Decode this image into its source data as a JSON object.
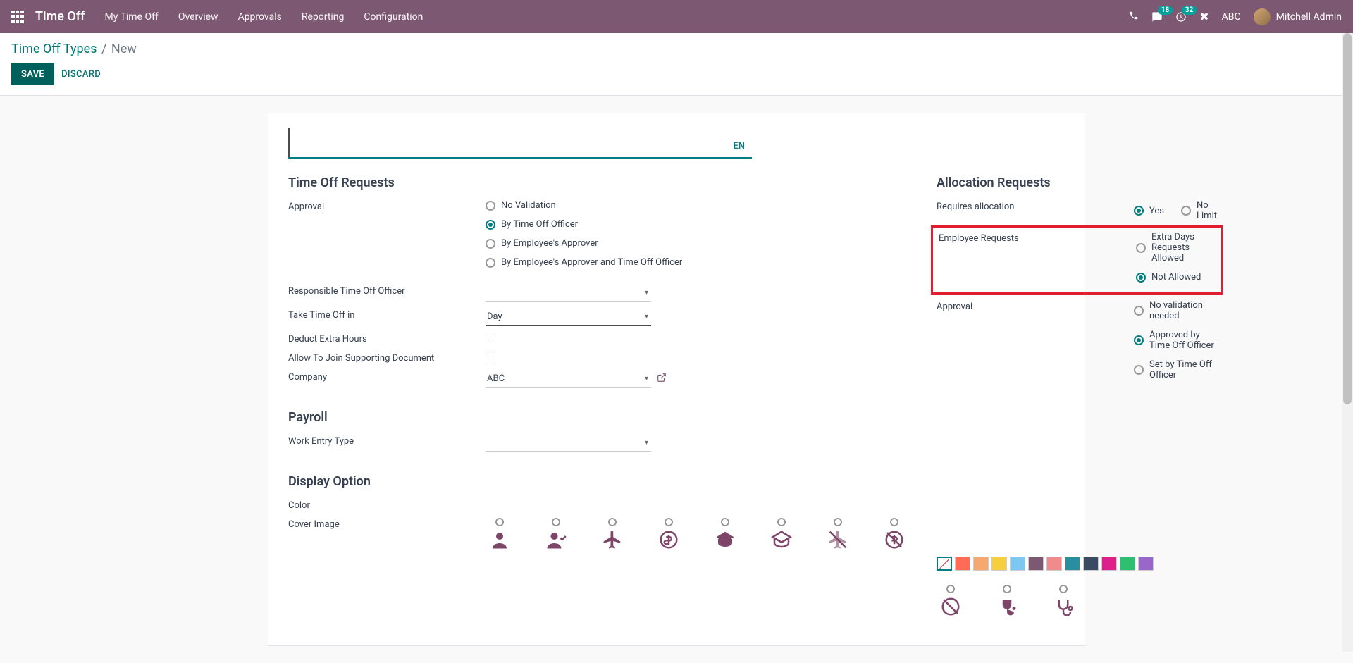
{
  "topbar": {
    "app_title": "Time Off",
    "menu": [
      "My Time Off",
      "Overview",
      "Approvals",
      "Reporting",
      "Configuration"
    ],
    "badges": {
      "messages": "18",
      "activities": "32"
    },
    "company_code": "ABC",
    "user_name": "Mitchell Admin"
  },
  "breadcrumb": {
    "parent": "Time Off Types",
    "current": "New"
  },
  "buttons": {
    "save": "SAVE",
    "discard": "DISCARD"
  },
  "lang_badge": "EN",
  "sections": {
    "left": {
      "title1": "Time Off Requests",
      "approval_label": "Approval",
      "approval_options": [
        "No Validation",
        "By Time Off Officer",
        "By Employee's Approver",
        "By Employee's Approver and Time Off Officer"
      ],
      "approval_selected": 1,
      "resp_label": "Responsible Time Off Officer",
      "take_label": "Take Time Off in",
      "take_value": "Day",
      "deduct_label": "Deduct Extra Hours",
      "allow_doc_label": "Allow To Join Supporting Document",
      "company_label": "Company",
      "company_value": "ABC",
      "title2": "Payroll",
      "work_entry_label": "Work Entry Type",
      "title3": "Display Option",
      "color_label": "Color",
      "cover_label": "Cover Image"
    },
    "right": {
      "title": "Allocation Requests",
      "req_alloc_label": "Requires allocation",
      "req_alloc_opts": [
        "Yes",
        "No Limit"
      ],
      "req_alloc_selected": 0,
      "emp_req_label": "Employee Requests",
      "emp_req_opts": [
        "Extra Days Requests Allowed",
        "Not Allowed"
      ],
      "emp_req_selected": 1,
      "approval_label": "Approval",
      "approval_opts": [
        "No validation needed",
        "Approved by Time Off Officer",
        "Set by Time Off Officer"
      ],
      "approval_selected": 1
    }
  },
  "colors": [
    "#ff4d3a",
    "#f29b3e",
    "#f7cf3e",
    "#6cc6f7",
    "#7d5872",
    "#f08b8b",
    "#2b8e9e",
    "#3a4a63",
    "#e0208a",
    "#2bbf6e",
    "#9966cc"
  ]
}
